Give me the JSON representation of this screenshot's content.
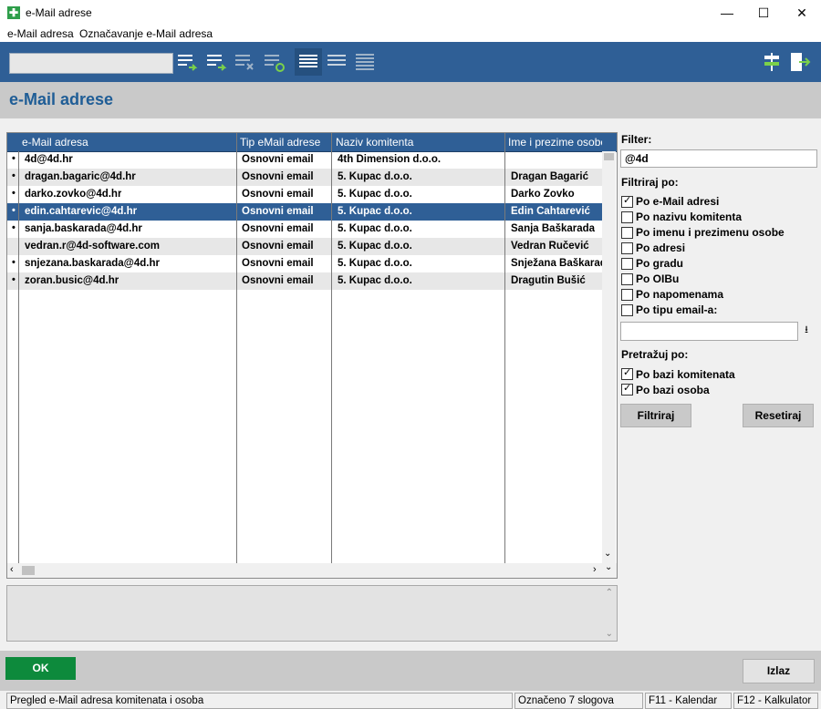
{
  "window": {
    "title": "e-Mail adrese",
    "minimize": "—",
    "maximize": "☐",
    "close": "✕"
  },
  "menu": {
    "items": [
      "e-Mail adresa",
      "Označavanje e-Mail adresa"
    ]
  },
  "toolbar": {
    "search_value": "",
    "icons": [
      "add-to-list-icon",
      "add-all-icon",
      "remove-icon",
      "refresh-list-icon",
      "list-view-1-icon",
      "list-view-2-icon",
      "list-view-3-icon",
      "signpost-icon",
      "exit-icon"
    ]
  },
  "page": {
    "title": "e-Mail adrese"
  },
  "table": {
    "columns": [
      "e-Mail adresa",
      "Tip eMail adrese",
      "Naziv komitenta",
      "Ime i prezime osobe"
    ],
    "rows": [
      {
        "marker": "•",
        "email": "4d@4d.hr",
        "type": "Osnovni email",
        "client": "4th Dimension d.o.o.",
        "person": ""
      },
      {
        "marker": "•",
        "email": "dragan.bagaric@4d.hr",
        "type": "Osnovni email",
        "client": "5. Kupac d.o.o.",
        "person": "Dragan Bagarić"
      },
      {
        "marker": "•",
        "email": "darko.zovko@4d.hr",
        "type": "Osnovni email",
        "client": "5. Kupac d.o.o.",
        "person": "Darko Zovko"
      },
      {
        "marker": "•",
        "email": "edin.cahtarevic@4d.hr",
        "type": "Osnovni email",
        "client": "5. Kupac d.o.o.",
        "person": "Edin Čahtarević"
      },
      {
        "marker": "•",
        "email": "sanja.baskarada@4d.hr",
        "type": "Osnovni email",
        "client": "5. Kupac d.o.o.",
        "person": "Sanja Baškarada"
      },
      {
        "marker": "",
        "email": "vedran.r@4d-software.com",
        "type": "Osnovni email",
        "client": "5. Kupac d.o.o.",
        "person": "Vedran Ručević"
      },
      {
        "marker": "•",
        "email": "snjezana.baskarada@4d.hr",
        "type": "Osnovni email",
        "client": "5. Kupac d.o.o.",
        "person": "Snježana Baškarada"
      },
      {
        "marker": "•",
        "email": "zoran.busic@4d.hr",
        "type": "Osnovni email",
        "client": "5. Kupac d.o.o.",
        "person": "Dragutin Bušić"
      }
    ],
    "selected_row": 3
  },
  "filter": {
    "label": "Filter:",
    "value": "@4d",
    "filter_by_label": "Filtriraj po:",
    "options": [
      {
        "label": "Po e-Mail adresi",
        "checked": true
      },
      {
        "label": "Po nazivu komitenta",
        "checked": false
      },
      {
        "label": "Po imenu i prezimenu osobe",
        "checked": false
      },
      {
        "label": "Po adresi",
        "checked": false
      },
      {
        "label": "Po gradu",
        "checked": false
      },
      {
        "label": "Po OIBu",
        "checked": false
      },
      {
        "label": "Po napomenama",
        "checked": false
      },
      {
        "label": "Po tipu email-a:",
        "checked": false
      }
    ],
    "type_value": "",
    "search_in_label": "Pretražuj po:",
    "search_in": [
      {
        "label": "Po bazi komitenata",
        "checked": true
      },
      {
        "label": "Po bazi osoba",
        "checked": true
      }
    ],
    "apply_label": "Filtriraj",
    "reset_label": "Resetiraj"
  },
  "buttons": {
    "ok": "OK",
    "exit": "Izlaz"
  },
  "status": {
    "description": "Pregled e-Mail adresa komitenata i osoba",
    "count": "Označeno 7 slogova",
    "f11": "F11 - Kalendar",
    "f12": "F12 - Kalkulator"
  },
  "colors": {
    "toolbar": "#2f5f96",
    "title": "#1f5d96",
    "ok": "#0d8a3c",
    "selected_row": "#2f5f96"
  }
}
